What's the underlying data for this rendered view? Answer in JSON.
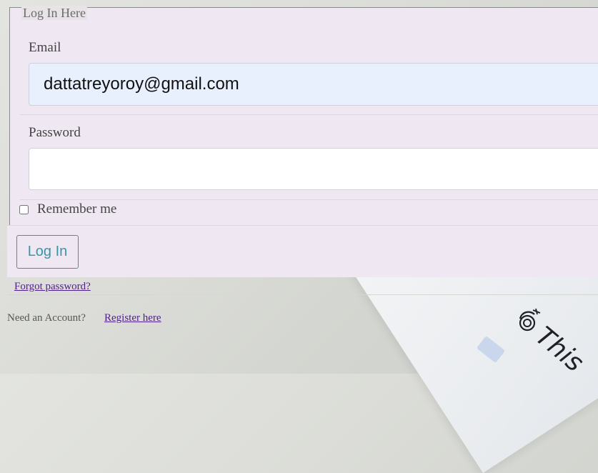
{
  "form": {
    "legend": "Log In Here",
    "email": {
      "label": "Email",
      "value": "dattatreyoroy@gmail.com"
    },
    "password": {
      "label": "Password",
      "value": ""
    },
    "remember": {
      "label": "Remember me",
      "checked": false
    },
    "submit_label": "Log In"
  },
  "links": {
    "forgot_password": "Forgot password?",
    "need_account": "Need an Account?",
    "register": "Register here"
  },
  "background": {
    "paper_text": "This",
    "paper_icon": "scribble-logo-icon"
  },
  "colors": {
    "button_accent": "#3a96a7",
    "link": "#4f1f87",
    "panel_bg": "#efe8f3",
    "autofill_bg": "#e8f0fe"
  }
}
